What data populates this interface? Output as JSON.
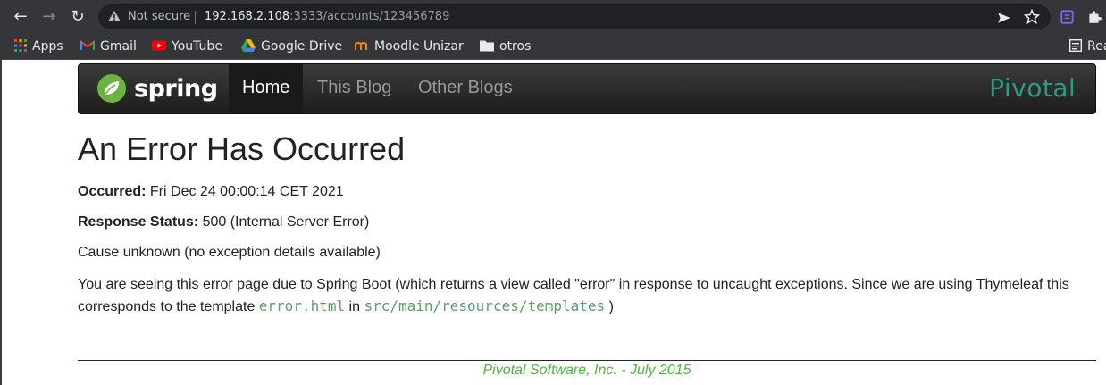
{
  "browser": {
    "back_icon": "←",
    "forward_icon": "→",
    "reload_icon": "↻",
    "security_label": "Not secure",
    "url_host": "192.168.2.108",
    "url_rest": ":3333/accounts/123456789",
    "bookmarks": [
      {
        "label": "Apps",
        "icon": "apps-grid-icon"
      },
      {
        "label": "Gmail",
        "icon": "gmail-icon"
      },
      {
        "label": "YouTube",
        "icon": "youtube-icon"
      },
      {
        "label": "Google Drive",
        "icon": "google-drive-icon"
      },
      {
        "label": "Moodle Unizar",
        "icon": "moodle-icon"
      },
      {
        "label": "otros",
        "icon": "folder-icon"
      }
    ],
    "reading_list_label": "Rea"
  },
  "navbar": {
    "brand": "spring",
    "items": [
      "Home",
      "This Blog",
      "Other Blogs"
    ],
    "active_item": "Home",
    "pivotal_logo": "Pivotal",
    "pivotal_dot": "."
  },
  "error": {
    "title": "An Error Has Occurred",
    "occurred_label": "Occurred:",
    "occurred_value": " Fri Dec 24 00:00:14 CET 2021",
    "status_label": "Response Status:",
    "status_value": " 500 (Internal Server Error)",
    "cause": "Cause unknown (no exception details available)",
    "explanation_1": "You are seeing this error page due to Spring Boot (which returns a view called \"error\" in response to uncaught exceptions. Since we are using Thymeleaf this corresponds to the template ",
    "template_file": "error.html",
    "explanation_2": " in ",
    "template_path": "src/main/resources/templates",
    "explanation_3": " )"
  },
  "footer": {
    "text": "Pivotal Software, Inc. - July 2015"
  },
  "colors": {
    "footer_text": "#53b243",
    "code_text": "#5a9e6f",
    "pivotal_logo": "#2f9a82",
    "spring_leaf": "#6db33f"
  }
}
